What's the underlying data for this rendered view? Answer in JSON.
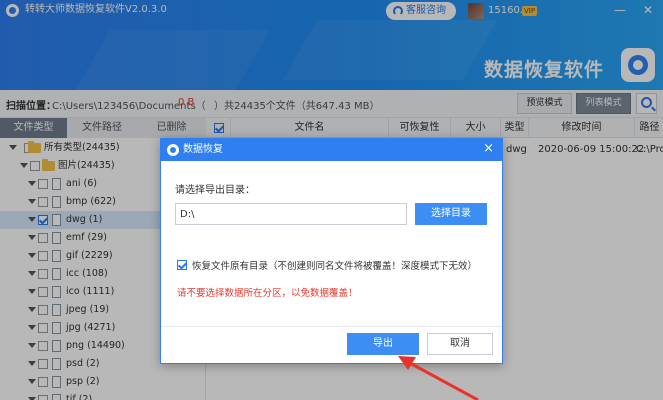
{
  "window": {
    "title": "转转大师数据恢复软件V2.0.3.0",
    "service_button": "客服咨询",
    "username": "15160...",
    "vip": "VIP",
    "minimize": "—",
    "close": "✕",
    "banner_title": "数据恢复软件"
  },
  "scanbar": {
    "label": "扫描位置：",
    "path": "C:\\Users\\123456\\Documents（",
    "size": "0 B",
    "total": "）共24435个文件（共647.43 MB）",
    "preview_mode": "预览模式",
    "list_mode": "列表模式"
  },
  "left_tabs": [
    "文件类型",
    "文件路径",
    "已删除"
  ],
  "tree": {
    "root": "所有类型(24435)",
    "images": "图片(24435)",
    "items": [
      "ani (6)",
      "bmp (622)",
      "dwg (1)",
      "emf (29)",
      "gif (2229)",
      "icc (108)",
      "ico (1111)",
      "jpeg (19)",
      "jpg (4271)",
      "png (14490)",
      "psd (2)",
      "psp (2)",
      "tif (2)"
    ]
  },
  "table": {
    "headers": [
      "文件名",
      "可恢复性",
      "大小",
      "类型",
      "修改时间",
      "路径"
    ],
    "row": {
      "type": "dwg",
      "mtime": "2020-06-09 15:00:22",
      "path": "C:\\Pro"
    }
  },
  "dialog": {
    "title": "数据恢复",
    "close": "×",
    "prompt": "请选择导出目录：",
    "path_value": "D:\\",
    "browse": "选择目录",
    "keep_dir": "恢复文件原有目录（不创建则同名文件将被覆盖！深度模式下无效）",
    "warning": "请不要选择数据所在分区，以免数据覆盖！",
    "export": "导出",
    "cancel": "取消"
  },
  "colors": {
    "accent": "#2f7ff0",
    "warning": "#e23b2e",
    "annotation_arrow": "#e8332a"
  }
}
